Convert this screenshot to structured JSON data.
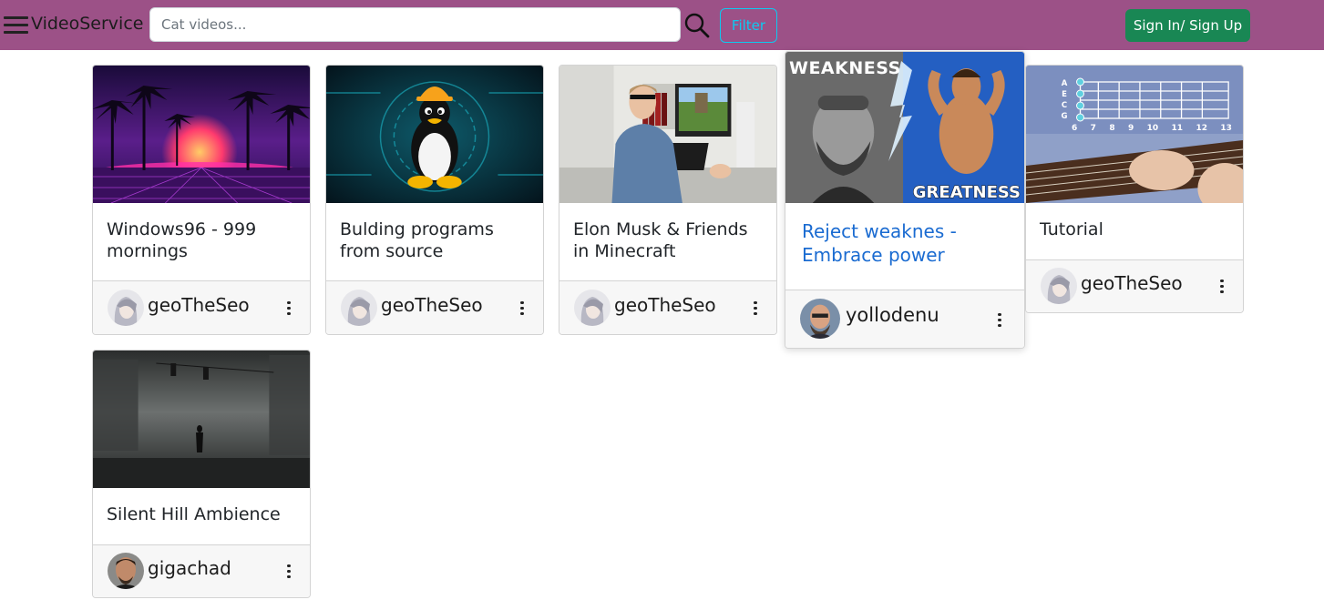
{
  "header": {
    "brand": "VideoService",
    "search": {
      "placeholder": "Cat videos...",
      "value": ""
    },
    "filter_label": "Filter",
    "signin_label": "Sign In/ Sign Up",
    "colors": {
      "navbar": "#9c5187",
      "filter": "#0dcaf0",
      "signin": "#198754"
    }
  },
  "videos": [
    {
      "title": "Windows96 - 999 mornings",
      "author": "geoTheSeo",
      "thumbnail": "synthwave-palm-sunset"
    },
    {
      "title": "Bulding programs from source",
      "author": "geoTheSeo",
      "thumbnail": "linux-penguin-hardhat"
    },
    {
      "title": "Elon Musk & Friends in Minecraft",
      "author": "geoTheSeo",
      "thumbnail": "man-at-desk-minecraft"
    },
    {
      "title": "Reject weaknes - Embrace power",
      "author": "yollodenu",
      "thumbnail": "weakness-greatness",
      "thumb_text": {
        "top": "WEAKNESS",
        "bottom": "GREATNESS"
      }
    },
    {
      "title": "Tutorial",
      "author": "geoTheSeo",
      "thumbnail": "ukulele-fretboard",
      "thumb_text": {
        "strings": [
          "A",
          "E",
          "C",
          "G"
        ],
        "frets": [
          "6",
          "7",
          "8",
          "9",
          "10",
          "11",
          "12",
          "13"
        ]
      }
    },
    {
      "title": "Silent Hill Ambience",
      "author": "gigachad",
      "thumbnail": "foggy-street"
    }
  ]
}
